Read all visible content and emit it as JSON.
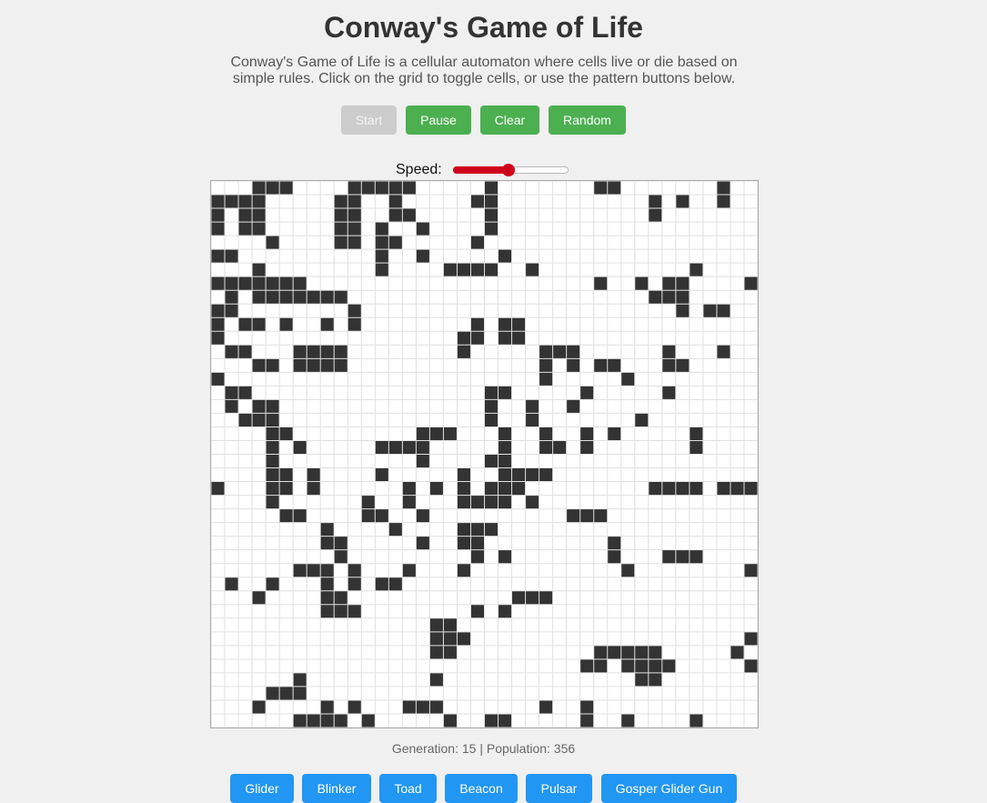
{
  "title": "Conway's Game of Life",
  "description": "Conway's Game of Life is a cellular automaton where cells live or die based on simple rules. Click on the grid to toggle cells, or use the pattern buttons below.",
  "controls": {
    "start_label": "Start",
    "start_disabled": true,
    "pause_label": "Pause",
    "clear_label": "Clear",
    "random_label": "Random"
  },
  "speed": {
    "label": "Speed:",
    "value_fraction": 0.48
  },
  "status": {
    "generation": 15,
    "population": 356,
    "text": "Generation: 15 | Population: 356"
  },
  "patterns": [
    "Glider",
    "Blinker",
    "Toad",
    "Beacon",
    "Pulsar",
    "Gosper Glider Gun"
  ],
  "colors": {
    "background": "#f0f0f0",
    "alive_cell": "#333333",
    "grid_line": "#e0e0e0",
    "control_button": "#4caf50",
    "disabled_button": "#cccccc",
    "pattern_button": "#2196f3",
    "slider_accent": "#d0021b"
  },
  "grid": {
    "cols": 40,
    "rows": 40,
    "cells": [
      "...XXX....XXXXX.....X.......XX.......X........",
      "XXXX.....XX..X.....XX...........X.X..X.....X",
      "X.XX.....XX..XX.....X...........X..........XX",
      "X.XX.....XX.X..X....X.....................X...",
      "....X....XX.XX.....X...........................",
      "XX..........X..X.....X..........................",
      "...X........X....XXXX..X...........X....X.......",
      "XXXXXXX.....................X..X.XX....X.XX",
      ".X.XXXXXXX......................XXX.....X....",
      "XX........X.......................X.XX.........",
      "X.XX.X..X.X........X.XX..........................",
      "X.................XX.XX......................X...",
      ".XX...XXXX........X.....XXX......X...X.....",
      "...XX.XXXX..............X.X.XX...XX........",
      "X.......................X.....X..................",
      ".XX.................XX.....X.....X.......X",
      ".X.XX...............X..X..X....................",
      "..XXX...............X..X.......X.............",
      "....XX.........XXX...X..X..X.X.....X..........",
      "....X.X.....XXXX.....X..XX.X.......X........",
      "....X..........X....XX...........................",
      "....XX.X....X.....X..XXXX.....................X",
      "X...XX.X......X.X.X.XXX.........XXXX.XXXX",
      "....X......X..X...XXXX.X......................XX..",
      ".....XX....XX..X..........XXX...........XXX.....X",
      "........X....X....XXX...................X.....",
      "........XX.....X..XX.........X............X.X",
      ".........X.........X.X.......X...XXX.......XXX",
      "......XXX.X...X...X...........X........X........",
      ".X..X...X.X.XX.....................................X",
      "...X....XX............XXX....................XX.X",
      "........XXX........X.X......................XX.X",
      "................XX........................XX..XXX",
      "................XXX....................XX..........",
      "................XX..........XXXXX.....X..........",
      "...........................XX.XXXX.....X..........",
      "......X.........X..............XX...........X.......",
      "....XXX.......................................X",
      "...X....X.X...XXX.......X..X..........................XX",
      "......XXXX.X.....X..XX.....X..X....X....XX...",
      "......X..X..XXX......XX....X..X....X..XXX..X....X"
    ]
  }
}
